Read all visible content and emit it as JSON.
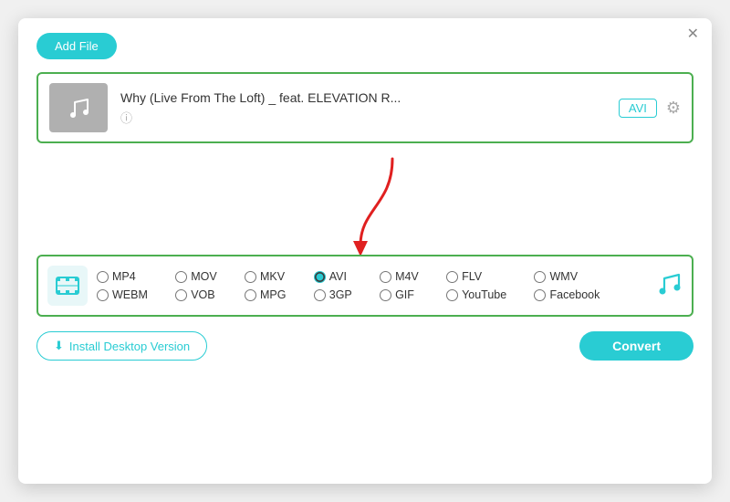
{
  "dialog": {
    "close_label": "✕",
    "add_file_label": "Add File"
  },
  "file": {
    "title": "Why (Live From The Loft) _ feat. ELEVATION R...",
    "format_badge": "AVI",
    "info_icon": "ⓘ"
  },
  "formats": {
    "options": [
      {
        "id": "mp4",
        "label": "MP4",
        "row": 0,
        "col": 0,
        "checked": false
      },
      {
        "id": "mov",
        "label": "MOV",
        "row": 0,
        "col": 1,
        "checked": false
      },
      {
        "id": "mkv",
        "label": "MKV",
        "row": 0,
        "col": 2,
        "checked": false
      },
      {
        "id": "avi",
        "label": "AVI",
        "row": 0,
        "col": 3,
        "checked": true
      },
      {
        "id": "m4v",
        "label": "M4V",
        "row": 0,
        "col": 4,
        "checked": false
      },
      {
        "id": "flv",
        "label": "FLV",
        "row": 0,
        "col": 5,
        "checked": false
      },
      {
        "id": "wmv",
        "label": "WMV",
        "row": 1,
        "col": 5,
        "checked": false
      },
      {
        "id": "webm",
        "label": "WEBM",
        "row": 1,
        "col": 0,
        "checked": false
      },
      {
        "id": "vob",
        "label": "VOB",
        "row": 1,
        "col": 1,
        "checked": false
      },
      {
        "id": "mpg",
        "label": "MPG",
        "row": 1,
        "col": 2,
        "checked": false
      },
      {
        "id": "3gp",
        "label": "3GP",
        "row": 1,
        "col": 3,
        "checked": false
      },
      {
        "id": "gif",
        "label": "GIF",
        "row": 1,
        "col": 4,
        "checked": false
      },
      {
        "id": "youtube",
        "label": "YouTube",
        "row": 1,
        "col": 5,
        "checked": false
      },
      {
        "id": "facebook",
        "label": "Facebook",
        "row": 1,
        "col": 6,
        "checked": false
      }
    ]
  },
  "bottom": {
    "install_label": "Install Desktop Version",
    "convert_label": "Convert"
  },
  "colors": {
    "accent": "#29ccd3",
    "green_border": "#4caf50",
    "red_arrow": "#e02020"
  }
}
